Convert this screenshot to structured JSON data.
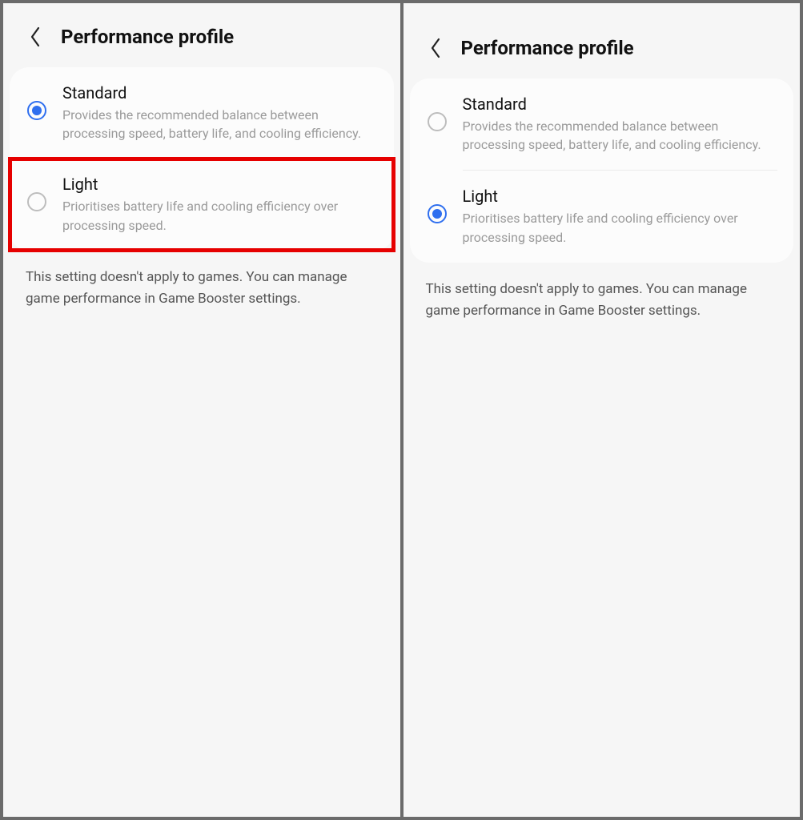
{
  "panels": [
    {
      "title": "Performance profile",
      "selectedIndex": 0,
      "highlightIndex": 1,
      "showDivider": false,
      "options": [
        {
          "title": "Standard",
          "desc": "Provides the recommended balance between processing speed, battery life, and cooling efficiency."
        },
        {
          "title": "Light",
          "desc": "Prioritises battery life and cooling efficiency over processing speed."
        }
      ],
      "footer": "This setting doesn't apply to games. You can manage game performance in Game Booster settings."
    },
    {
      "title": "Performance profile",
      "selectedIndex": 1,
      "highlightIndex": -1,
      "showDivider": true,
      "options": [
        {
          "title": "Standard",
          "desc": "Provides the recommended balance between processing speed, battery life, and cooling efficiency."
        },
        {
          "title": "Light",
          "desc": "Prioritises battery life and cooling efficiency over processing speed."
        }
      ],
      "footer": "This setting doesn't apply to games. You can manage game performance in Game Booster settings."
    }
  ]
}
